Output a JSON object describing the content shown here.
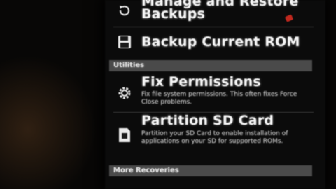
{
  "menu": {
    "manage_restore": {
      "title_line1": "Manage and Restore",
      "title_line2": "Backups",
      "icon": "restore-icon"
    },
    "backup_current": {
      "title": "Backup Current ROM",
      "icon": "floppy-disk-icon"
    },
    "utilities_header": "Utilities",
    "fix_permissions": {
      "title": "Fix Permissions",
      "desc": "Fix file system permissions. This often fixes Force Close problems.",
      "icon": "gear-icon"
    },
    "partition_sd": {
      "title": "Partition SD Card",
      "desc": "Partition your SD Card to enable installation of applications on your SD for supported ROMs.",
      "icon": "sd-card-icon"
    },
    "more_recoveries_header": "More Recoveries"
  },
  "colors": {
    "background": "#0b0b0b",
    "section_header": "#4a4a4a",
    "text": "#f2f2f2"
  }
}
